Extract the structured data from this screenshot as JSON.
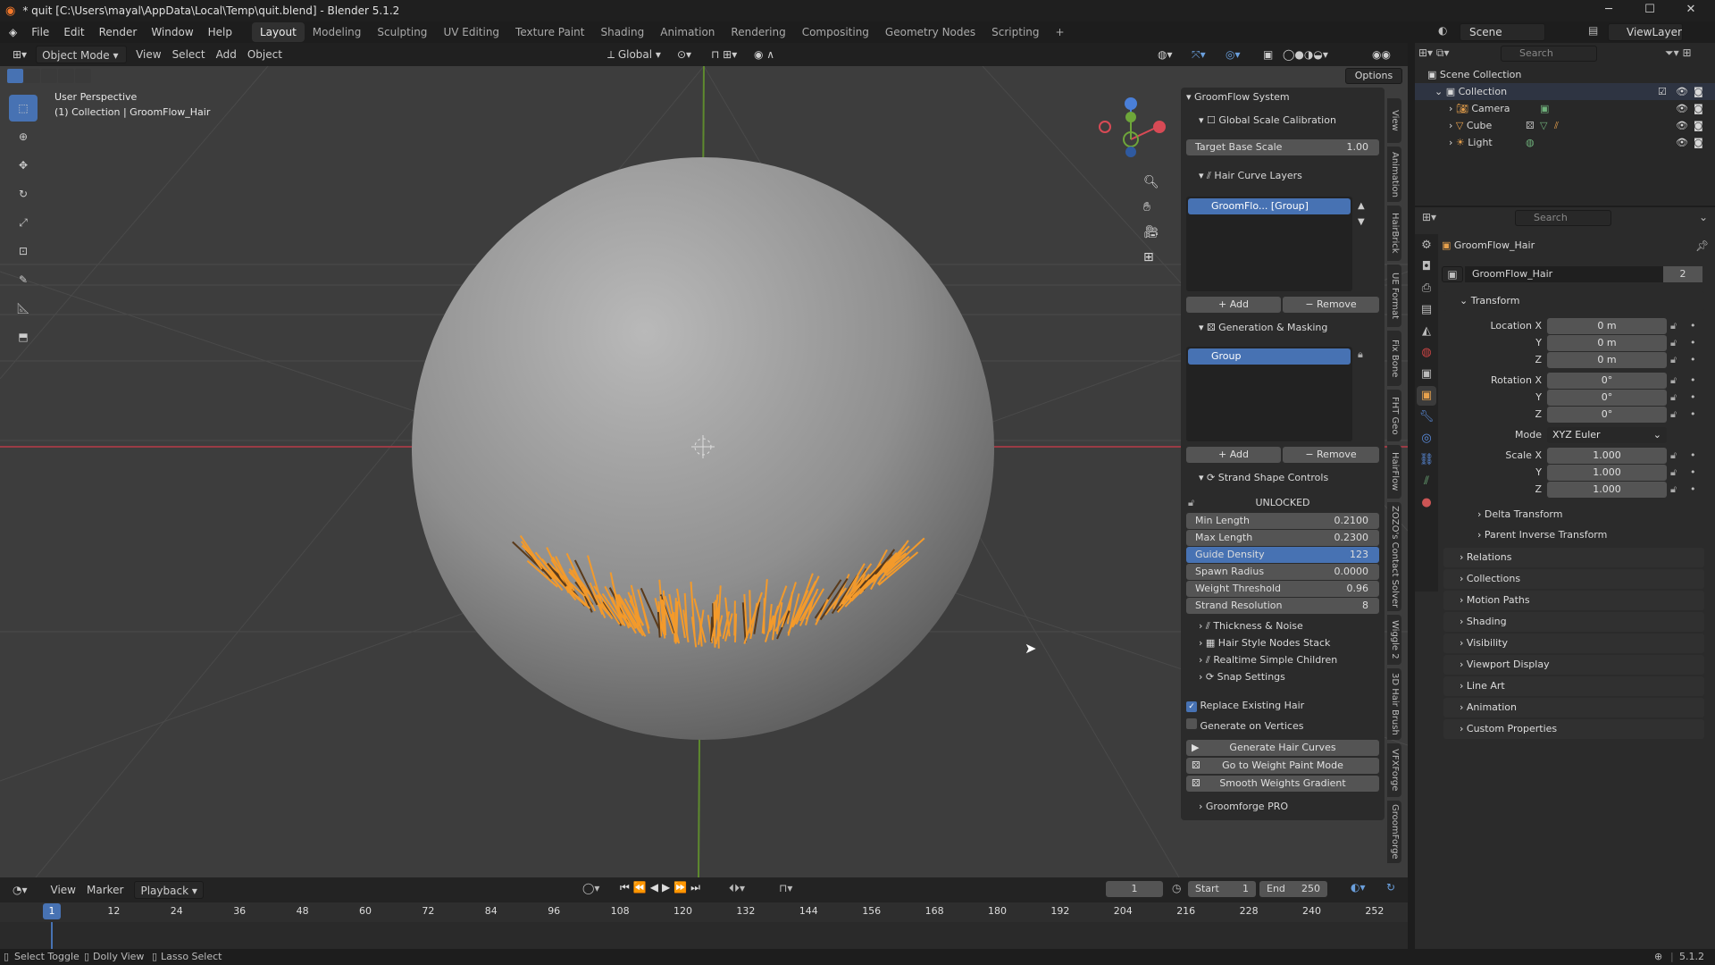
{
  "window": {
    "title": "* quit [C:\\Users\\mayal\\AppData\\Local\\Temp\\quit.blend] - Blender 5.1.2",
    "minimize": "─",
    "maximize": "☐",
    "close": "✕"
  },
  "menubar": {
    "items": [
      "File",
      "Edit",
      "Render",
      "Window",
      "Help"
    ],
    "workspaces": [
      "Layout",
      "Modeling",
      "Sculpting",
      "UV Editing",
      "Texture Paint",
      "Shading",
      "Animation",
      "Rendering",
      "Compositing",
      "Geometry Nodes",
      "Scripting"
    ],
    "active_workspace": "Layout",
    "add_tab": "+",
    "scene_label": "Scene",
    "viewlayer_label": "ViewLayer"
  },
  "viewport_header": {
    "mode": "Object Mode",
    "menus": [
      "View",
      "Select",
      "Add",
      "Object"
    ],
    "orientation": "Global",
    "options": "Options"
  },
  "viewport": {
    "perspective": "User Perspective",
    "collection_info": "(1) Collection | GroomFlow_Hair",
    "background_color": "#3d3d3d",
    "sphere_color": "#8a8a8a",
    "hair_color": "#f39a2b"
  },
  "npanel": {
    "system_title": "GroomFlow System",
    "calib_title": "Global Scale Calibration",
    "target_base_scale_label": "Target Base Scale",
    "target_base_scale_value": "1.00",
    "hair_layers_title": "Hair Curve Layers",
    "layer_item": "GroomFlo...  [Group]",
    "add_label": "Add",
    "remove_label": "Remove",
    "gen_mask_title": "Generation & Masking",
    "group_item": "Group",
    "strand_title": "Strand Shape Controls",
    "unlocked": "UNLOCKED",
    "fields": [
      {
        "label": "Min Length",
        "value": "0.2100"
      },
      {
        "label": "Max Length",
        "value": "0.2300"
      },
      {
        "label": "Guide Density",
        "value": "123"
      },
      {
        "label": "Spawn Radius",
        "value": "0.0000"
      },
      {
        "label": "Weight Threshold",
        "value": "0.96"
      },
      {
        "label": "Strand Resolution",
        "value": "8"
      }
    ],
    "subsections": [
      "Thickness & Noise",
      "Hair Style Nodes Stack",
      "Realtime Simple Children",
      "Snap Settings"
    ],
    "replace_existing": "Replace Existing Hair",
    "generate_on_vertices": "Generate on Vertices",
    "generate_btn": "Generate Hair Curves",
    "weight_paint_btn": "Go to Weight Paint Mode",
    "smooth_btn": "Smooth Weights Gradient",
    "groomforge": "Groomforge PRO",
    "side_tabs": [
      "View",
      "Animation",
      "HairBrick",
      "UE Format",
      "Fix Bone",
      "FHT Geo",
      "HairFlow",
      "ZOZO's Contact Solver",
      "Wiggle 2",
      "3D Hair Brush",
      "VFXForge",
      "GroomForge"
    ]
  },
  "outliner": {
    "search_placeholder": "Search",
    "scene_collection": "Scene Collection",
    "collection": "Collection",
    "objects": [
      "Camera",
      "Cube",
      "Light"
    ]
  },
  "properties": {
    "search_placeholder": "Search",
    "object_name": "GroomFlow_Hair",
    "data_name": "GroomFlow_Hair",
    "users": "2",
    "transform_title": "Transform",
    "location_label": "Location X",
    "rotation_label": "Rotation X",
    "scale_label": "Scale X",
    "axis_y": "Y",
    "axis_z": "Z",
    "location": [
      "0 m",
      "0 m",
      "0 m"
    ],
    "rotation": [
      "0°",
      "0°",
      "0°"
    ],
    "mode_label": "Mode",
    "mode_value": "XYZ Euler",
    "scale": [
      "1.000",
      "1.000",
      "1.000"
    ],
    "delta": "Delta Transform",
    "parent_inverse": "Parent Inverse Transform",
    "sections": [
      "Relations",
      "Collections",
      "Motion Paths",
      "Shading",
      "Visibility",
      "Viewport Display",
      "Line Art",
      "Animation",
      "Custom Properties"
    ]
  },
  "timeline": {
    "menus": [
      "View",
      "Marker",
      "Playback"
    ],
    "current_frame": "1",
    "start_label": "Start",
    "start": "1",
    "end_label": "End",
    "end": "250",
    "ticks": [
      "1",
      "12",
      "24",
      "36",
      "48",
      "60",
      "72",
      "84",
      "96",
      "108",
      "120",
      "132",
      "144",
      "156",
      "168",
      "180",
      "192",
      "204",
      "216",
      "228",
      "240",
      "252"
    ]
  },
  "statusbar": {
    "select_toggle": "Select Toggle",
    "dolly_view": "Dolly View",
    "lasso_select": "Lasso Select",
    "version": "5.1.2"
  }
}
